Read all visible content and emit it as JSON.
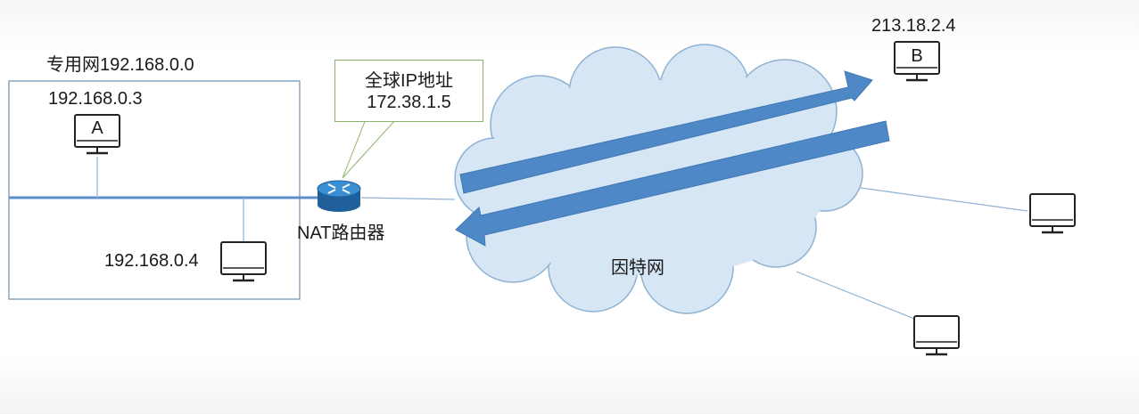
{
  "private_net": {
    "title": "专用网192.168.0.0",
    "host_a": {
      "ip": "192.168.0.3",
      "name": "A"
    },
    "host_2": {
      "ip": "192.168.0.4"
    }
  },
  "router": {
    "label": "NAT路由器",
    "callout_line1": "全球IP地址",
    "callout_line2": "172.38.1.5"
  },
  "internet": {
    "label": "因特网"
  },
  "host_b": {
    "ip": "213.18.2.4",
    "name": "B"
  },
  "colors": {
    "box_border": "#6f8fb0",
    "lan_line": "#5b8fc9",
    "thin_line": "#8fb2d3",
    "cloud_fill": "#d7e6f4",
    "cloud_stroke": "#8fb2d3",
    "arrow": "#4f88c6",
    "callout_border": "#8db36a",
    "router_fill": "#2f80c4"
  }
}
